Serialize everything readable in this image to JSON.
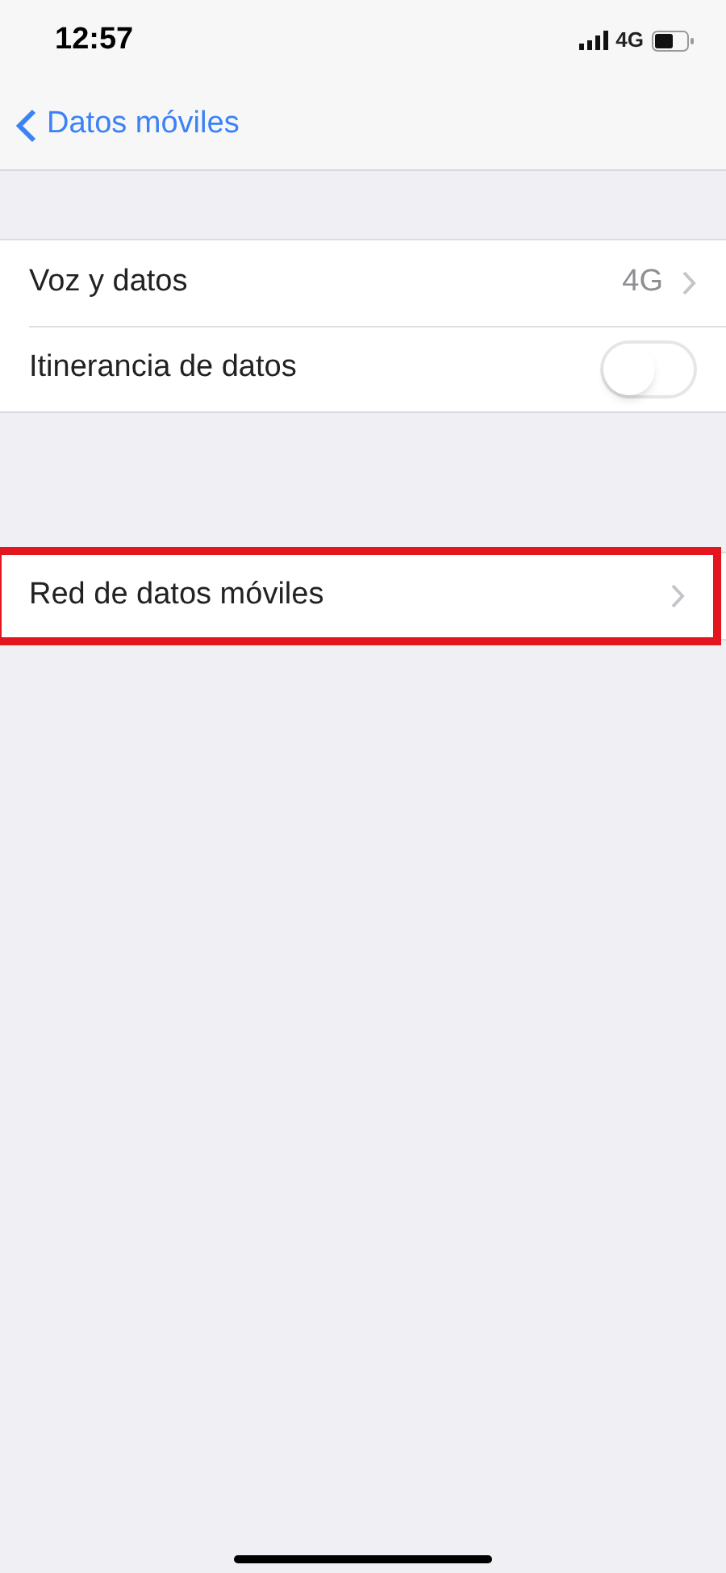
{
  "status_bar": {
    "time": "12:57",
    "network": "4G"
  },
  "nav": {
    "back_label": "Datos móviles"
  },
  "sections": [
    {
      "rows": [
        {
          "kind": "value",
          "label": "Voz y datos",
          "value": "4G"
        },
        {
          "kind": "toggle",
          "label": "Itinerancia de datos",
          "on": false
        }
      ]
    },
    {
      "rows": [
        {
          "kind": "link",
          "label": "Red de datos móviles",
          "highlighted": true
        }
      ]
    }
  ]
}
